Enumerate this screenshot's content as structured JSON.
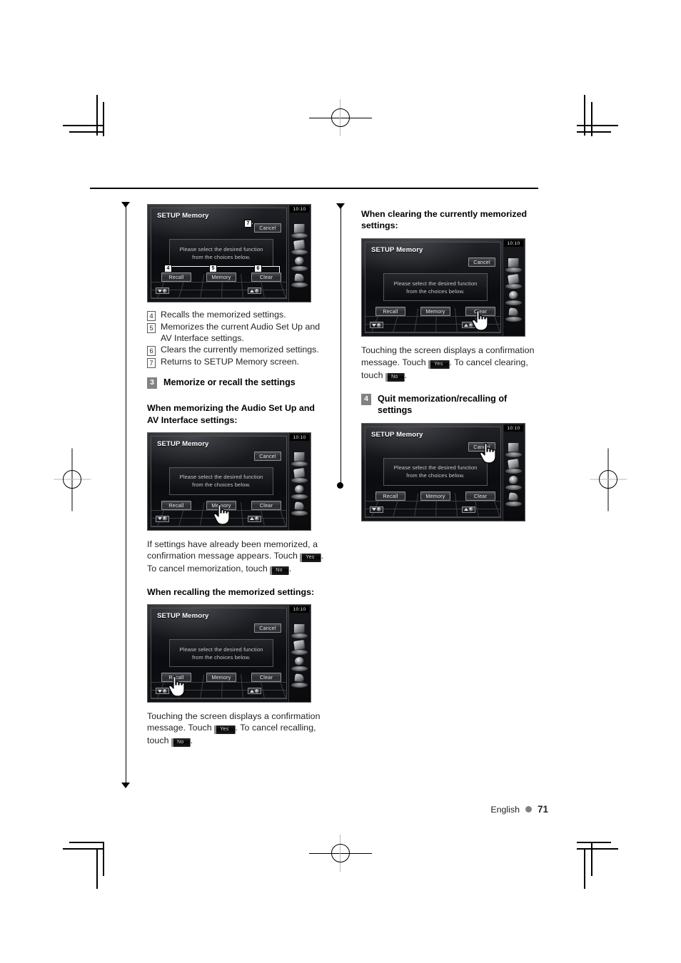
{
  "page": {
    "language_label": "English",
    "page_number": "71"
  },
  "device_screen": {
    "title": "SETUP Memory",
    "clock": "10:10",
    "message_line1": "Please select the desired function",
    "message_line2": "from the choices below.",
    "buttons": {
      "recall": "Recall",
      "memory": "Memory",
      "clear": "Clear",
      "cancel": "Cancel"
    }
  },
  "left_column": {
    "figure1_tags": {
      "recall": "4",
      "memory": "5",
      "clear": "6",
      "cancel": "7"
    },
    "callouts": [
      {
        "num": "4",
        "text": "Recalls the memorized settings."
      },
      {
        "num": "5",
        "text": "Memorizes the current Audio Set Up and AV Interface settings."
      },
      {
        "num": "6",
        "text": "Clears the currently memorized settings."
      },
      {
        "num": "7",
        "text": "Returns to SETUP Memory screen."
      }
    ],
    "step3": {
      "num": "3",
      "title": "Memorize or recall the settings"
    },
    "sub_memorizing": "When memorizing the Audio Set Up and AV Interface settings:",
    "memorizing_body": {
      "part1": "If settings have already been memorized, a confirmation message appears. Touch ",
      "key_yes": "Yes",
      "part2": ". To cancel memorization, touch ",
      "key_no": "No",
      "part3": "."
    },
    "sub_recalling": "When recalling the memorized settings:",
    "recalling_body": {
      "part1": "Touching the screen displays a confirmation message. Touch ",
      "key_yes": "Yes",
      "part2": ". To cancel recalling, touch ",
      "key_no": "No",
      "part3": "."
    }
  },
  "right_column": {
    "sub_clearing": "When clearing the currently memorized settings:",
    "clearing_body": {
      "part1": "Touching the screen displays a confirmation message. Touch ",
      "key_yes": "Yes",
      "part2": ". To cancel clearing, touch ",
      "key_no": "No",
      "part3": "."
    },
    "step4": {
      "num": "4",
      "title": "Quit memorization/recalling of settings"
    }
  }
}
